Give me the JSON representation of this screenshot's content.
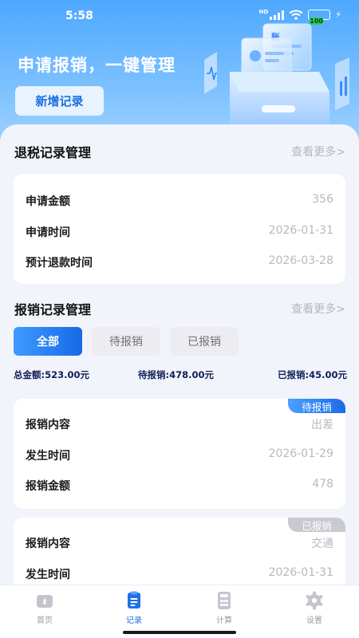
{
  "status_bar": {
    "time": "5:58",
    "network": "HD",
    "battery": "100"
  },
  "hero": {
    "title": "申请报销，一键管理",
    "add_button": "新增记录"
  },
  "tax_refund": {
    "title": "退税记录管理",
    "more": "查看更多>",
    "rows": [
      {
        "label": "申请金额",
        "value": "356"
      },
      {
        "label": "申请时间",
        "value": "2026-01-31"
      },
      {
        "label": "预计退款时间",
        "value": "2026-03-28"
      }
    ]
  },
  "reimburse": {
    "title": "报销记录管理",
    "more": "查看更多>",
    "filters": [
      "全部",
      "待报销",
      "已报销"
    ],
    "totals": {
      "total": "总金额:523.00元",
      "pending": "待报销:478.00元",
      "done": "已报销:45.00元"
    },
    "cards": [
      {
        "tag": "待报销",
        "rows": [
          {
            "label": "报销内容",
            "value": "出差"
          },
          {
            "label": "发生时间",
            "value": "2026-01-29"
          },
          {
            "label": "报销金额",
            "value": "478"
          }
        ]
      },
      {
        "tag": "已报销",
        "rows": [
          {
            "label": "报销内容",
            "value": "交通"
          },
          {
            "label": "发生时间",
            "value": "2026-01-31"
          }
        ]
      }
    ]
  },
  "tabbar": [
    {
      "label": "首页",
      "icon": "home-icon"
    },
    {
      "label": "记录",
      "icon": "record-icon"
    },
    {
      "label": "计算",
      "icon": "calculator-icon"
    },
    {
      "label": "设置",
      "icon": "gear-icon"
    }
  ],
  "colors": {
    "accent": "#1f6fe5",
    "hero_top": "#4ea8ff",
    "muted": "#b8b8c0"
  }
}
